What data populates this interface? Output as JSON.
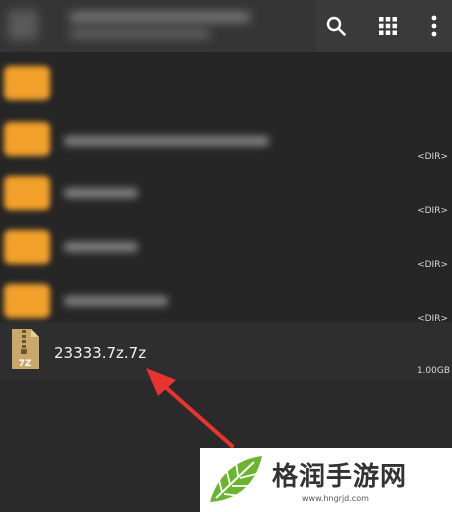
{
  "toolbar": {
    "icons": [
      "search-icon",
      "grid-view-icon",
      "more-vert-icon"
    ]
  },
  "list": {
    "folders": [
      {
        "type": "<DIR>"
      },
      {
        "type": "<DIR>"
      },
      {
        "type": "<DIR>"
      },
      {
        "type": "<DIR>"
      }
    ],
    "archive": {
      "name": "23333.7z.7z",
      "icon_label": "7Z",
      "size": "1.00GB"
    }
  },
  "watermark": {
    "brand": "格润手游网",
    "url": "www.hngrjd.com"
  },
  "colors": {
    "folder": "#f2a02a",
    "arrow": "#e8332e",
    "zip_icon": "#c9a86a",
    "watermark_green": "#6bb52e"
  }
}
